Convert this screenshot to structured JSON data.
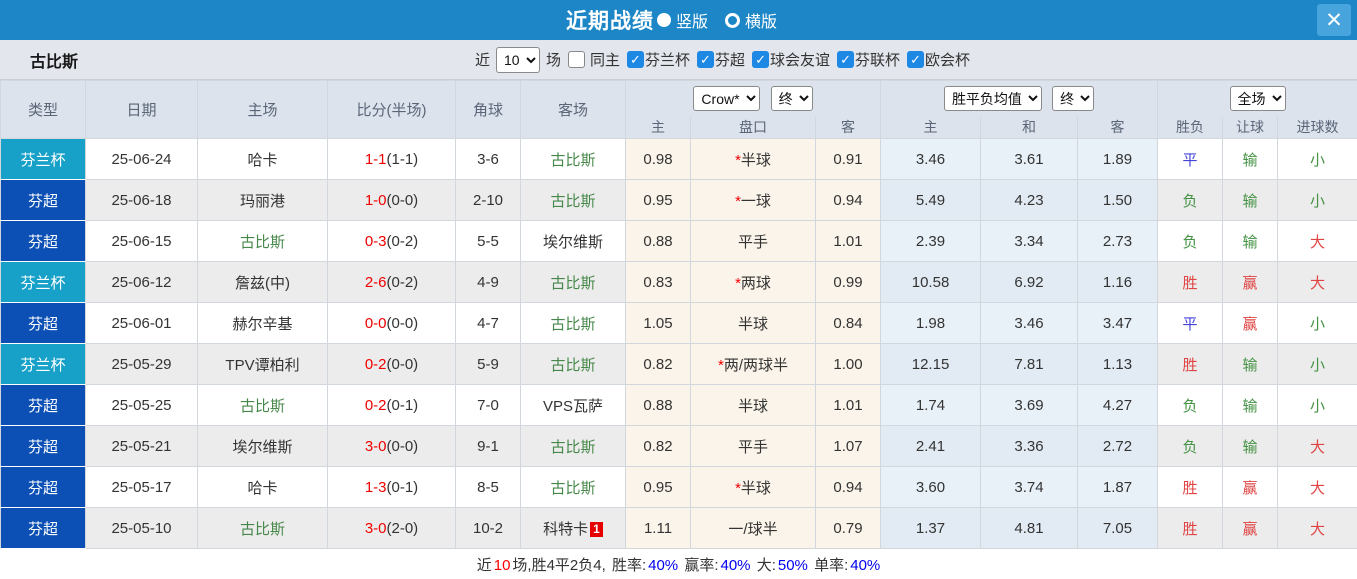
{
  "title_bar": {
    "title": "近期战绩",
    "radio_vertical_label": "竖版",
    "radio_horizontal_label": "横版",
    "vertical_selected": true,
    "close_icon": "✕"
  },
  "filter_bar": {
    "team_name": "古比斯",
    "recent_label": "近",
    "recent_count": "10",
    "unit_label": "场",
    "same_home": {
      "label": "同主",
      "checked": false,
      "check_icon": "✓"
    },
    "leagues": [
      {
        "label": "芬兰杯",
        "checked": true
      },
      {
        "label": "芬超",
        "checked": true
      },
      {
        "label": "球会友谊",
        "checked": true
      },
      {
        "label": "芬联杯",
        "checked": true
      },
      {
        "label": "欧会杯",
        "checked": true
      }
    ]
  },
  "table": {
    "header": {
      "type": "类型",
      "date": "日期",
      "home": "主场",
      "score": "比分(半场)",
      "corner": "角球",
      "away": "客场",
      "odds_company_select": "Crow*",
      "odds_state_select": "终",
      "avg_select": "胜平负均值",
      "avg_state_select": "终",
      "scope_select": "全场",
      "sub_home": "主",
      "sub_handicap": "盘口",
      "sub_away": "客",
      "sub_win": "主",
      "sub_draw": "和",
      "sub_lose": "客",
      "sub_result": "胜负",
      "sub_asian": "让球",
      "sub_goals": "进球数"
    },
    "rows": [
      {
        "type": "芬兰杯",
        "type_style": "cup",
        "date": "25-06-24",
        "home": "哈卡",
        "home_target": false,
        "score": "1-1",
        "half": "(1-1)",
        "corner": "3-6",
        "away": "古比斯",
        "away_target": true,
        "away_badge": "",
        "odds_home": "0.98",
        "star": true,
        "handicap": "半球",
        "odds_away": "0.91",
        "avg_win": "3.46",
        "avg_draw": "3.61",
        "avg_lose": "1.89",
        "result": "平",
        "result_color": "blue",
        "asian": "输",
        "asian_color": "green",
        "goals": "小",
        "goals_color": "green"
      },
      {
        "type": "芬超",
        "type_style": "super",
        "date": "25-06-18",
        "home": "玛丽港",
        "home_target": false,
        "score": "1-0",
        "half": "(0-0)",
        "corner": "2-10",
        "away": "古比斯",
        "away_target": true,
        "away_badge": "",
        "odds_home": "0.95",
        "star": true,
        "handicap": "一球",
        "odds_away": "0.94",
        "avg_win": "5.49",
        "avg_draw": "4.23",
        "avg_lose": "1.50",
        "result": "负",
        "result_color": "green",
        "asian": "输",
        "asian_color": "green",
        "goals": "小",
        "goals_color": "green"
      },
      {
        "type": "芬超",
        "type_style": "super",
        "date": "25-06-15",
        "home": "古比斯",
        "home_target": true,
        "score": "0-3",
        "half": "(0-2)",
        "corner": "5-5",
        "away": "埃尔维斯",
        "away_target": false,
        "away_badge": "",
        "odds_home": "0.88",
        "star": false,
        "handicap": "平手",
        "odds_away": "1.01",
        "avg_win": "2.39",
        "avg_draw": "3.34",
        "avg_lose": "2.73",
        "result": "负",
        "result_color": "green",
        "asian": "输",
        "asian_color": "green",
        "goals": "大",
        "goals_color": "red"
      },
      {
        "type": "芬兰杯",
        "type_style": "cup",
        "date": "25-06-12",
        "home": "詹兹(中)",
        "home_target": false,
        "score": "2-6",
        "half": "(0-2)",
        "corner": "4-9",
        "away": "古比斯",
        "away_target": true,
        "away_badge": "",
        "odds_home": "0.83",
        "star": true,
        "handicap": "两球",
        "odds_away": "0.99",
        "avg_win": "10.58",
        "avg_draw": "6.92",
        "avg_lose": "1.16",
        "result": "胜",
        "result_color": "red",
        "asian": "赢",
        "asian_color": "red",
        "goals": "大",
        "goals_color": "red"
      },
      {
        "type": "芬超",
        "type_style": "super",
        "date": "25-06-01",
        "home": "赫尔辛基",
        "home_target": false,
        "score": "0-0",
        "half": "(0-0)",
        "corner": "4-7",
        "away": "古比斯",
        "away_target": true,
        "away_badge": "",
        "odds_home": "1.05",
        "star": false,
        "handicap": "半球",
        "odds_away": "0.84",
        "avg_win": "1.98",
        "avg_draw": "3.46",
        "avg_lose": "3.47",
        "result": "平",
        "result_color": "blue",
        "asian": "赢",
        "asian_color": "red",
        "goals": "小",
        "goals_color": "green"
      },
      {
        "type": "芬兰杯",
        "type_style": "cup",
        "date": "25-05-29",
        "home": "TPV谭柏利",
        "home_target": false,
        "score": "0-2",
        "half": "(0-0)",
        "corner": "5-9",
        "away": "古比斯",
        "away_target": true,
        "away_badge": "",
        "odds_home": "0.82",
        "star": true,
        "handicap": "两/两球半",
        "odds_away": "1.00",
        "avg_win": "12.15",
        "avg_draw": "7.81",
        "avg_lose": "1.13",
        "result": "胜",
        "result_color": "red",
        "asian": "输",
        "asian_color": "green",
        "goals": "小",
        "goals_color": "green"
      },
      {
        "type": "芬超",
        "type_style": "super",
        "date": "25-05-25",
        "home": "古比斯",
        "home_target": true,
        "score": "0-2",
        "half": "(0-1)",
        "corner": "7-0",
        "away": "VPS瓦萨",
        "away_target": false,
        "away_badge": "",
        "odds_home": "0.88",
        "star": false,
        "handicap": "半球",
        "odds_away": "1.01",
        "avg_win": "1.74",
        "avg_draw": "3.69",
        "avg_lose": "4.27",
        "result": "负",
        "result_color": "green",
        "asian": "输",
        "asian_color": "green",
        "goals": "小",
        "goals_color": "green"
      },
      {
        "type": "芬超",
        "type_style": "super",
        "date": "25-05-21",
        "home": "埃尔维斯",
        "home_target": false,
        "score": "3-0",
        "half": "(0-0)",
        "corner": "9-1",
        "away": "古比斯",
        "away_target": true,
        "away_badge": "",
        "odds_home": "0.82",
        "star": false,
        "handicap": "平手",
        "odds_away": "1.07",
        "avg_win": "2.41",
        "avg_draw": "3.36",
        "avg_lose": "2.72",
        "result": "负",
        "result_color": "green",
        "asian": "输",
        "asian_color": "green",
        "goals": "大",
        "goals_color": "red"
      },
      {
        "type": "芬超",
        "type_style": "super",
        "date": "25-05-17",
        "home": "哈卡",
        "home_target": false,
        "score": "1-3",
        "half": "(0-1)",
        "corner": "8-5",
        "away": "古比斯",
        "away_target": true,
        "away_badge": "",
        "odds_home": "0.95",
        "star": true,
        "handicap": "半球",
        "odds_away": "0.94",
        "avg_win": "3.60",
        "avg_draw": "3.74",
        "avg_lose": "1.87",
        "result": "胜",
        "result_color": "red",
        "asian": "赢",
        "asian_color": "red",
        "goals": "大",
        "goals_color": "red"
      },
      {
        "type": "芬超",
        "type_style": "super",
        "date": "25-05-10",
        "home": "古比斯",
        "home_target": true,
        "score": "3-0",
        "half": "(2-0)",
        "corner": "10-2",
        "away": "科特卡",
        "away_target": false,
        "away_badge": "1",
        "odds_home": "1.11",
        "star": false,
        "handicap": "一/球半",
        "odds_away": "0.79",
        "avg_win": "1.37",
        "avg_draw": "4.81",
        "avg_lose": "7.05",
        "result": "胜",
        "result_color": "red",
        "asian": "赢",
        "asian_color": "red",
        "goals": "大",
        "goals_color": "red"
      }
    ]
  },
  "footer": {
    "parts": [
      {
        "text": "近",
        "color": "#333333"
      },
      {
        "text": "10",
        "color": "#ff0000"
      },
      {
        "text": "场,胜4平2负4, ",
        "color": "#333333"
      },
      {
        "text": "胜率:",
        "color": "#333333"
      },
      {
        "text": "40%",
        "color": "#0000ee"
      },
      {
        "text": " 赢率:",
        "color": "#333333"
      },
      {
        "text": "40%",
        "color": "#0000ee"
      },
      {
        "text": " 大:",
        "color": "#333333"
      },
      {
        "text": "50%",
        "color": "#0000ee"
      },
      {
        "text": " 单率:",
        "color": "#333333"
      },
      {
        "text": "40%",
        "color": "#0000ee"
      }
    ]
  },
  "colors": {
    "titlebar_blue": "#1c86c7",
    "close_button_blue": "#47a4dd",
    "cup_badge": "#17a1c8",
    "league_badge": "#0c50b5",
    "target_team_green": "#46884a",
    "score_red": "#f00000",
    "win_red": "#e04343",
    "lose_green": "#449244",
    "draw_blue": "#4343d8",
    "odds_cell_cream": "#fbf4ea",
    "avg_cell_blue": "#e8f1f8",
    "checkbox_blue": "#1e88e5"
  }
}
